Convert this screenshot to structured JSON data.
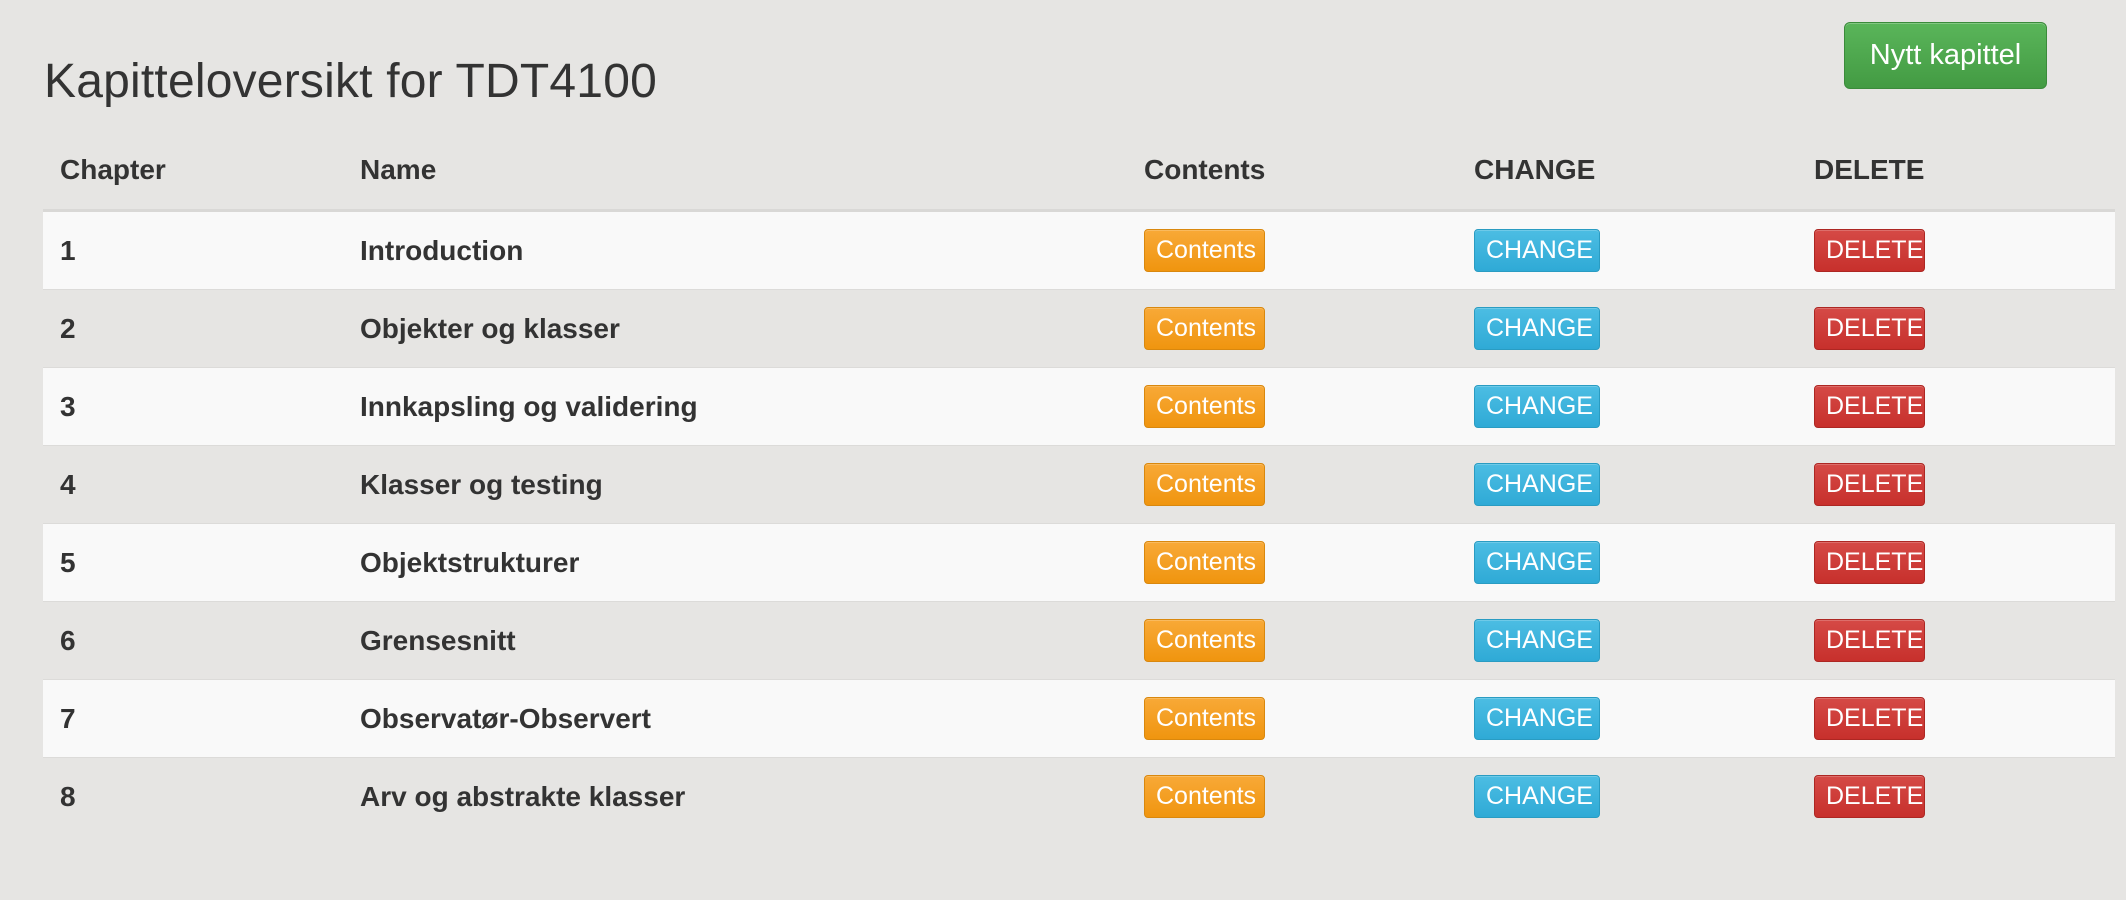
{
  "page": {
    "title": "Kapitteloversikt for TDT4100",
    "new_chapter_label": "Nytt kapittel"
  },
  "table": {
    "headers": {
      "chapter": "Chapter",
      "name": "Name",
      "contents": "Contents",
      "change": "CHANGE",
      "delete": "DELETE"
    },
    "rows": [
      {
        "chapter": "1",
        "name": "Introduction",
        "contents_label": "Contents",
        "change_label": "CHANGE",
        "delete_label": "DELETE"
      },
      {
        "chapter": "2",
        "name": "Objekter og klasser",
        "contents_label": "Contents",
        "change_label": "CHANGE",
        "delete_label": "DELETE"
      },
      {
        "chapter": "3",
        "name": "Innkapsling og validering",
        "contents_label": "Contents",
        "change_label": "CHANGE",
        "delete_label": "DELETE"
      },
      {
        "chapter": "4",
        "name": "Klasser og testing",
        "contents_label": "Contents",
        "change_label": "CHANGE",
        "delete_label": "DELETE"
      },
      {
        "chapter": "5",
        "name": "Objektstrukturer",
        "contents_label": "Contents",
        "change_label": "CHANGE",
        "delete_label": "DELETE"
      },
      {
        "chapter": "6",
        "name": "Grensesnitt",
        "contents_label": "Contents",
        "change_label": "CHANGE",
        "delete_label": "DELETE"
      },
      {
        "chapter": "7",
        "name": "Observatør-Observert",
        "contents_label": "Contents",
        "change_label": "CHANGE",
        "delete_label": "DELETE"
      },
      {
        "chapter": "8",
        "name": "Arv og abstrakte klasser",
        "contents_label": "Contents",
        "change_label": "CHANGE",
        "delete_label": "DELETE"
      }
    ]
  },
  "colors": {
    "page_background": "#e6e5e3",
    "success": "#4cae4c",
    "warning": "#f0ad4e",
    "info": "#31b0d5",
    "danger": "#d9534f"
  }
}
